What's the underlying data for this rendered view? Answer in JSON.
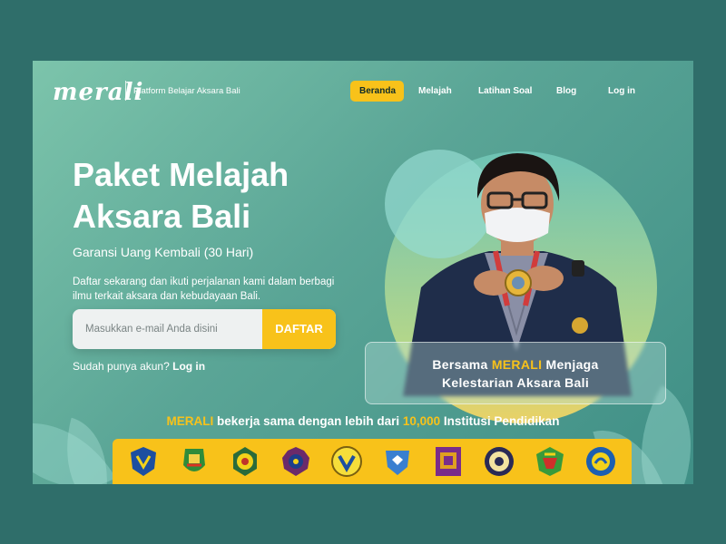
{
  "brand": {
    "logo": "merali",
    "tagline": "Platform Belajar Aksara Bali"
  },
  "nav": {
    "items": [
      {
        "label": "Beranda",
        "active": true
      },
      {
        "label": "Melajah",
        "active": false
      },
      {
        "label": "Latihan Soal",
        "active": false
      },
      {
        "label": "Blog",
        "active": false
      },
      {
        "label": "Log in",
        "active": false
      }
    ]
  },
  "hero": {
    "title_line1": "Paket Melajah",
    "title_line2": "Aksara Bali",
    "subtitle": "Garansi Uang Kembali (30 Hari)",
    "description": "Daftar sekarang dan ikuti perjalanan kami dalam berbagi ilmu terkait aksara dan kebudayaan Bali.",
    "email_placeholder": "Masukkan e-mail Anda disini",
    "cta_label": "DAFTAR",
    "login_prompt": "Sudah punya akun?",
    "login_link": "Log in"
  },
  "quote": {
    "prefix": "Bersama ",
    "highlight": "MERALI",
    "suffix": " Menjaga",
    "line2": "Kelestarian Aksara Bali"
  },
  "partners": {
    "brand": "MERALI",
    "text_mid": " bekerja sama dengan lebih dari ",
    "count": "10,000",
    "text_end": " Institusi Pendidikan",
    "logos": [
      "emblem-1",
      "emblem-2",
      "emblem-3",
      "emblem-4",
      "emblem-5",
      "emblem-6",
      "emblem-7",
      "emblem-8",
      "emblem-9",
      "emblem-10"
    ]
  },
  "colors": {
    "accent": "#f8c21a",
    "primary": "#5aa596",
    "background": "#2f6e6a"
  }
}
